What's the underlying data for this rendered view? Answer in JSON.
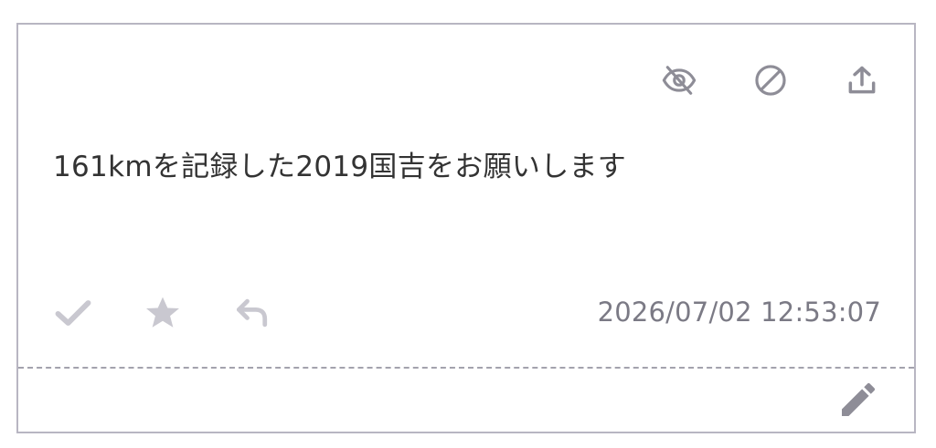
{
  "post": {
    "message": "161kmを記録した2019国吉をお願いします",
    "timestamp": "2026/07/02 12:53:07"
  },
  "icons": {
    "top": [
      "eye-off-icon",
      "block-icon",
      "share-upload-icon"
    ],
    "bottom": [
      "check-icon",
      "star-icon",
      "reply-icon"
    ],
    "edit": "pencil-icon"
  },
  "colors": {
    "top_icon": "#8e8d97",
    "action_icon": "#c9c8d0",
    "timestamp": "#7b7a85",
    "text": "#333333",
    "border": "#b8b6c2",
    "edit_icon": "#8e8d97"
  }
}
